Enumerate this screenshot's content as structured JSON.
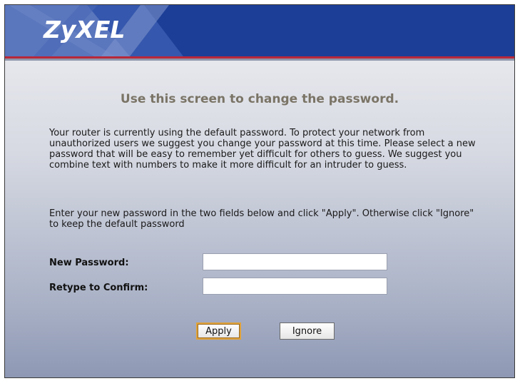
{
  "header": {
    "logo_text": "ZyXEL"
  },
  "main": {
    "title": "Use this screen to change the password.",
    "paragraph1": "Your router is currently using the default password. To protect your network from unauthorized users we suggest you change your password at this time. Please select a new password that will be easy to remember yet difficult for others to guess. We suggest you combine text with numbers to make it more difficult for an intruder to guess.",
    "paragraph2": "Enter your new password in the two fields below and click \"Apply\". Otherwise click \"Ignore\" to keep the default password"
  },
  "form": {
    "new_password_label": "New Password:",
    "new_password_value": "",
    "confirm_label": "Retype to Confirm:",
    "confirm_value": ""
  },
  "buttons": {
    "apply_label": "Apply",
    "ignore_label": "Ignore"
  },
  "colors": {
    "header_blue": "#1c3e96",
    "accent_red": "#b8283a",
    "title_gray": "#7a7466",
    "default_button_border": "#e0a23a"
  }
}
